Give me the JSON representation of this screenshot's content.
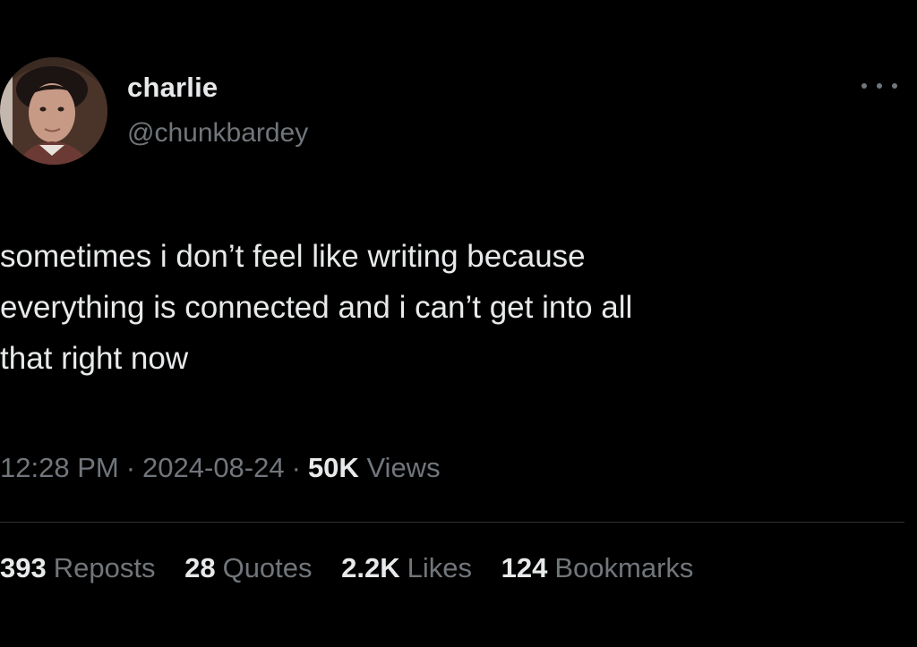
{
  "author": {
    "name": "charlie",
    "handle": "@chunkbardey"
  },
  "tweet": {
    "text": "sometimes i don’t feel like writing because\neverything is connected and i can’t get into all\nthat right now",
    "time": "12:28 PM",
    "separator": "·",
    "date": "2024-08-24",
    "views_count": "50K",
    "views_label": "Views"
  },
  "stats": {
    "reposts": {
      "count": "393",
      "label": "Reposts"
    },
    "quotes": {
      "count": "28",
      "label": "Quotes"
    },
    "likes": {
      "count": "2.2K",
      "label": "Likes"
    },
    "bookmarks": {
      "count": "124",
      "label": "Bookmarks"
    }
  },
  "icons": {
    "more": "more-options-icon"
  },
  "colors": {
    "background": "#000000",
    "primary_text": "#e7e9ea",
    "secondary_text": "#71767b",
    "divider": "#2f3336"
  }
}
